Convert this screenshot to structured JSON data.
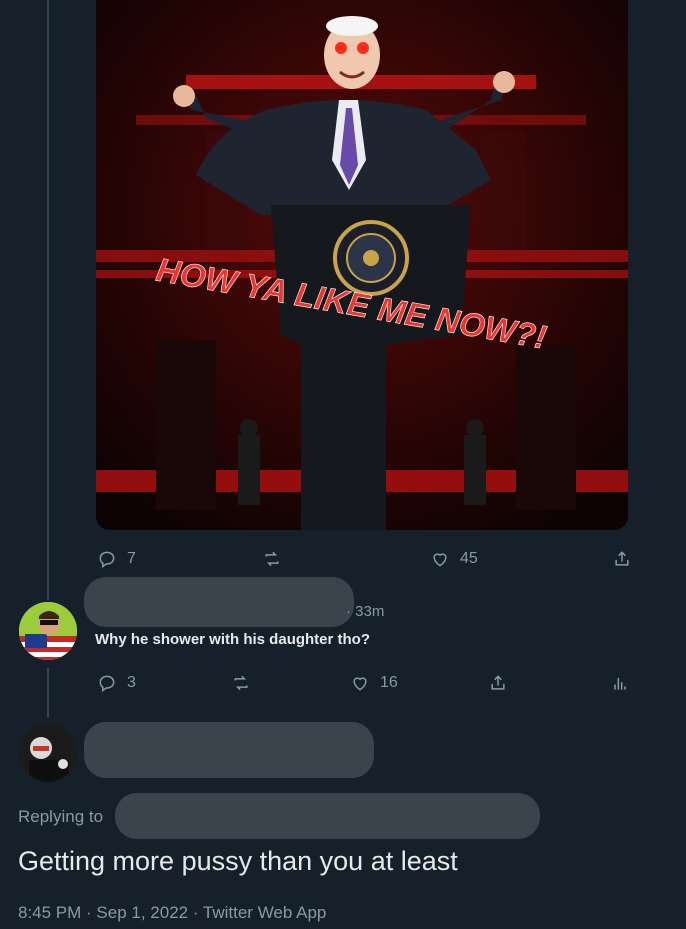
{
  "media": {
    "caption": "HOW YA LIKE ME NOW?!",
    "seal_text": "PRESIDENT OF THE UNITED STATES"
  },
  "top_actions": {
    "replies": "7",
    "retweets": "",
    "likes": "45"
  },
  "reply": {
    "time": "· 33m",
    "text": "Why he shower with his daughter tho?",
    "replies": "3",
    "retweets": "",
    "likes": "16"
  },
  "main_tweet": {
    "replying_to_label": "Replying to",
    "text": "Getting more pussy than you at least",
    "meta": "8:45 PM · Sep 1, 2022 · Twitter Web App"
  },
  "colors": {
    "background": "#15202b",
    "muted": "#8b98a5",
    "text": "#e7e9ea",
    "caption": "#e8372f"
  },
  "icons": [
    "reply-icon",
    "retweet-icon",
    "like-icon",
    "share-icon",
    "analytics-icon"
  ]
}
